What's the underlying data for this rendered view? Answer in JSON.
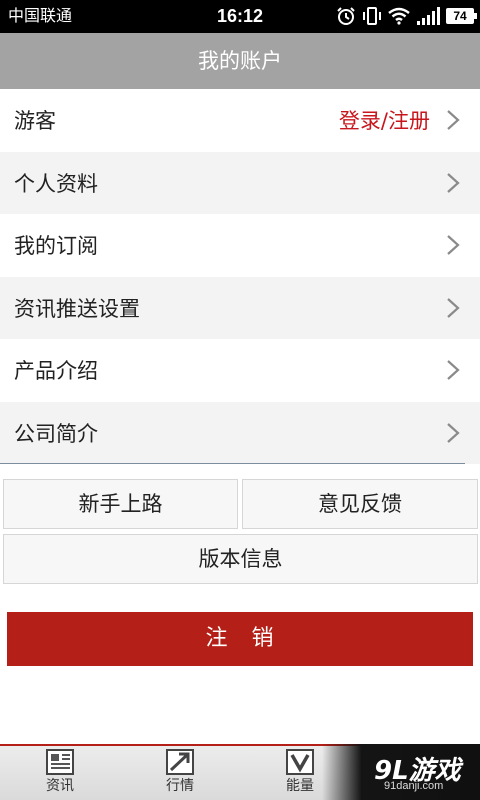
{
  "status_bar": {
    "carrier": "中国联通",
    "time": "16:12",
    "battery": "74",
    "icons": [
      "alarm-icon",
      "vibrate-icon",
      "wifi-icon",
      "signal-icon",
      "battery-icon"
    ]
  },
  "header": {
    "title": "我的账户"
  },
  "menu": {
    "guest_label": "游客",
    "login_label": "登录/注册",
    "items": [
      {
        "label": "个人资料"
      },
      {
        "label": "我的订阅"
      },
      {
        "label": "资讯推送设置"
      },
      {
        "label": "产品介绍"
      },
      {
        "label": "公司简介"
      }
    ]
  },
  "buttons": {
    "newbie": "新手上路",
    "feedback": "意见反馈",
    "version": "版本信息",
    "logout": "注　销"
  },
  "tabbar": {
    "tabs": [
      {
        "label": "资讯",
        "icon": "news-icon"
      },
      {
        "label": "行情",
        "icon": "market-chart-icon"
      },
      {
        "label": "能量",
        "icon": "energy-icon"
      }
    ]
  },
  "watermark": {
    "logo": "9L游戏",
    "url": "91danji.com"
  },
  "colors": {
    "accent": "#b41f17",
    "login": "#c8161d",
    "header_bg": "#a3a3a3"
  }
}
